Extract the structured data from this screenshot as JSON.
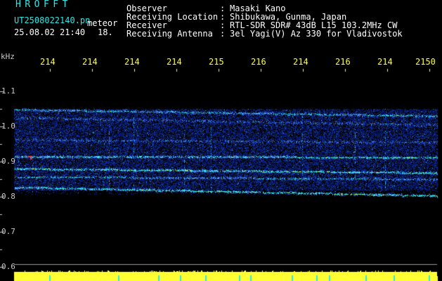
{
  "header": {
    "title": "HROFFT",
    "filename": "UT2508022140.pn",
    "meteor": "meteor",
    "stamp": "25.08.02 21:40",
    "code": "18.",
    "rows": [
      {
        "label": "Observer",
        "value": "Masaki Kano"
      },
      {
        "label": "Receiving Location",
        "value": "Shibukawa, Gunma, Japan"
      },
      {
        "label": "Receiver",
        "value": "RTL-SDR SDR# 43dB L15 103.2MHz CW"
      },
      {
        "label": "Receiving Antenna",
        "value": "3el Yagi(V) Az 330 for Vladivostok"
      }
    ],
    "colon": ":"
  },
  "chart_data": {
    "type": "heatmap",
    "ylabel": "kHz",
    "x_ticks": [
      "214",
      "214",
      "214",
      "214",
      "215",
      "216",
      "214",
      "216",
      "214",
      "2150"
    ],
    "y_ticks": [
      "1.1",
      "1.0",
      "0.9",
      "0.8",
      "0.7",
      "0.6"
    ],
    "y_tick_values": [
      1.1,
      1.0,
      0.9,
      0.8,
      0.7,
      0.6
    ],
    "ylim": [
      0.6,
      1.1
    ],
    "bands_khz": [
      {
        "start": 1.048,
        "end": 1.03,
        "strength": 0.75
      },
      {
        "start": 1.025,
        "end": 1.005,
        "strength": 0.45
      },
      {
        "start": 0.915,
        "end": 0.912,
        "strength": 0.85
      },
      {
        "start": 0.88,
        "end": 0.868,
        "strength": 0.9
      },
      {
        "start": 0.857,
        "end": 0.85,
        "strength": 0.65
      },
      {
        "start": 0.827,
        "end": 0.803,
        "strength": 0.9
      },
      {
        "start": 0.962,
        "end": 0.955,
        "strength": 0.45
      }
    ],
    "noise_floor_khz": [
      0.82,
      1.05
    ],
    "colors": {
      "background": "#000000",
      "noise": "#1a2fb0",
      "signal": "#2ee6e6",
      "peak": "#ffff33",
      "hot": "#ff3030"
    }
  }
}
